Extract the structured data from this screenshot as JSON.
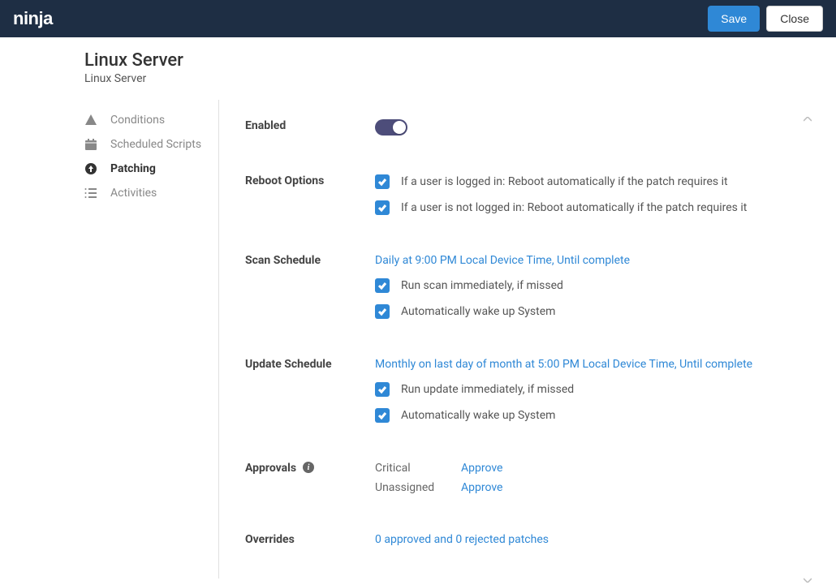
{
  "header": {
    "logo_text": "ninja",
    "save_label": "Save",
    "close_label": "Close"
  },
  "page": {
    "title": "Linux Server",
    "subtitle": "Linux Server"
  },
  "sidebar": {
    "items": [
      {
        "label": "Conditions",
        "icon": "warning-icon"
      },
      {
        "label": "Scheduled Scripts",
        "icon": "calendar-icon"
      },
      {
        "label": "Patching",
        "icon": "arrow-up-circle-icon",
        "active": true
      },
      {
        "label": "Activities",
        "icon": "list-icon"
      }
    ]
  },
  "sections": {
    "enabled": {
      "label": "Enabled",
      "value": true
    },
    "reboot": {
      "label": "Reboot Options",
      "items": [
        {
          "label": "If a user is logged in: Reboot automatically if the patch requires it",
          "checked": true
        },
        {
          "label": "If a user is not logged in: Reboot automatically if the patch requires it",
          "checked": true
        }
      ]
    },
    "scan": {
      "label": "Scan Schedule",
      "schedule_link": "Daily at 9:00 PM Local Device Time, Until complete",
      "items": [
        {
          "label": "Run scan immediately, if missed",
          "checked": true
        },
        {
          "label": "Automatically wake up System",
          "checked": true
        }
      ]
    },
    "update": {
      "label": "Update Schedule",
      "schedule_link": "Monthly on last day of month at 5:00 PM Local Device Time, Until complete",
      "items": [
        {
          "label": "Run update immediately, if missed",
          "checked": true
        },
        {
          "label": "Automatically wake up System",
          "checked": true
        }
      ]
    },
    "approvals": {
      "label": "Approvals",
      "rows": [
        {
          "name": "Critical",
          "action": "Approve"
        },
        {
          "name": "Unassigned",
          "action": "Approve"
        }
      ]
    },
    "overrides": {
      "label": "Overrides",
      "link": "0 approved and 0 rejected patches"
    }
  }
}
